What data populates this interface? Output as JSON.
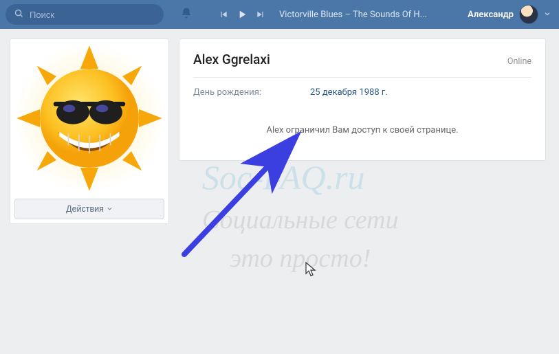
{
  "header": {
    "search_placeholder": "Поиск",
    "track_title": "Victorville Blues – The Sounds Of H...",
    "user_name": "Александр"
  },
  "sidebar": {
    "actions_label": "Действия"
  },
  "profile": {
    "name": "Alex Ggrelaxi",
    "status": "Online",
    "birthday_label": "День рождения:",
    "birthday_value": "25 декабря 1988 г.",
    "restricted_message": "Alex ограничил Вам доступ к своей странице."
  },
  "watermark": {
    "line1": "Soc-FAQ.ru",
    "line2": "Социальные сети",
    "line3": "это просто!"
  },
  "colors": {
    "brand": "#4a76a8",
    "link": "#2a5885"
  }
}
